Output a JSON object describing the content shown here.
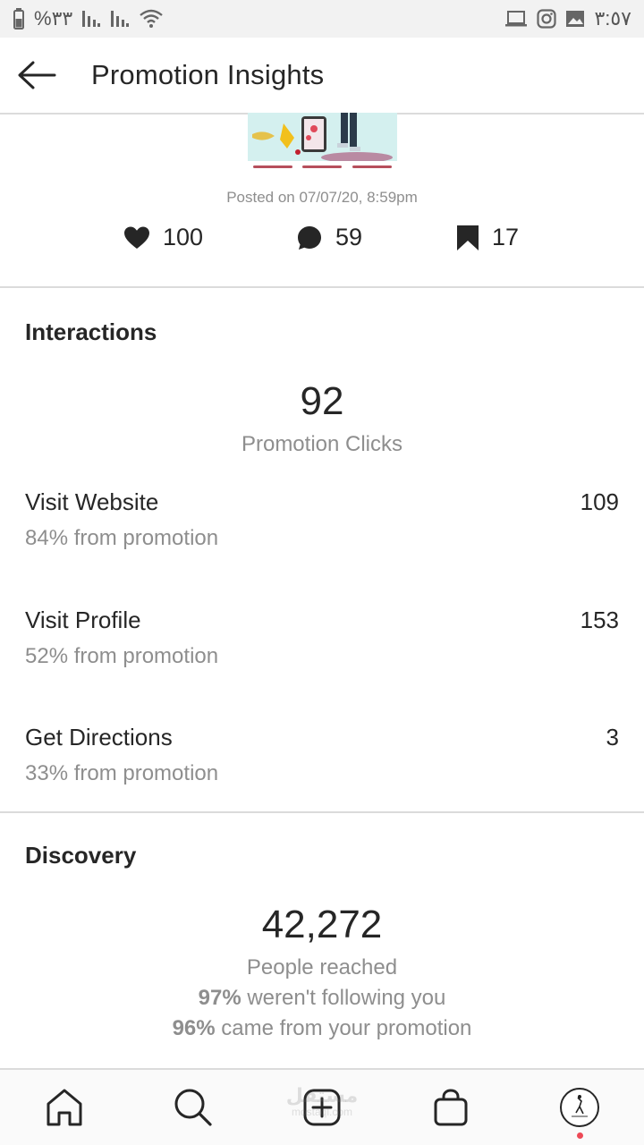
{
  "status_bar": {
    "battery_text": "%٣٣",
    "time": "٣:٥٧",
    "icons": [
      "battery-icon",
      "signal-icon",
      "signal-icon",
      "wifi-icon",
      "laptop-icon",
      "instagram-icon",
      "image-icon"
    ]
  },
  "header": {
    "title": "Promotion Insights",
    "back_icon": "arrow-left-icon"
  },
  "post": {
    "posted_on": "Posted on 07/07/20, 8:59pm",
    "likes": "100",
    "comments": "59",
    "saves": "17"
  },
  "interactions": {
    "title": "Interactions",
    "clicks_value": "92",
    "clicks_label": "Promotion Clicks",
    "rows": [
      {
        "label": "Visit Website",
        "value": "109",
        "sub": "84% from promotion"
      },
      {
        "label": "Visit Profile",
        "value": "153",
        "sub": "52% from promotion"
      },
      {
        "label": "Get Directions",
        "value": "3",
        "sub": "33% from promotion"
      }
    ]
  },
  "discovery": {
    "title": "Discovery",
    "reached_value": "42,272",
    "reached_label": "People reached",
    "not_following_pct": "97%",
    "not_following_text": " weren't following you",
    "from_promo_pct": "96%",
    "from_promo_text": " came from your promotion"
  },
  "bottom_nav": {
    "items": [
      "home-icon",
      "search-icon",
      "new-post-icon",
      "shop-icon",
      "profile-avatar"
    ],
    "watermark": "مستقل",
    "watermark_sub": "mostaql.com"
  },
  "colors": {
    "text_primary": "#262626",
    "text_secondary": "#8e8e8e",
    "divider": "#dbdbdb",
    "notification_dot": "#ed4956"
  }
}
